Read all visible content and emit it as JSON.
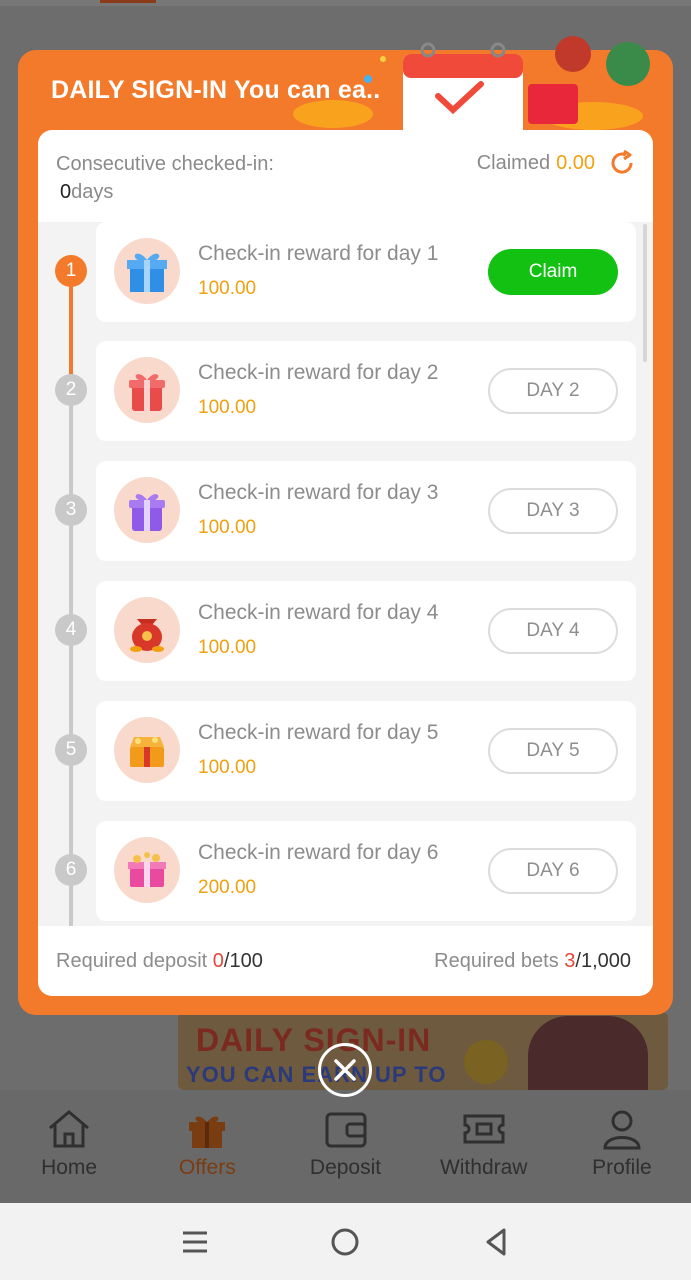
{
  "modal": {
    "title": "DAILY SIGN-IN You can ea..",
    "consecutive_label": "Consecutive checked-in:",
    "consecutive_value": "0",
    "consecutive_unit": "days",
    "claimed_label": "Claimed",
    "claimed_value": "0.00",
    "rows": [
      {
        "step": "1",
        "title": "Check-in reward for day 1",
        "amount": "100.00",
        "button": "Claim",
        "state": "claim"
      },
      {
        "step": "2",
        "title": "Check-in reward for day 2",
        "amount": "100.00",
        "button": "DAY 2",
        "state": "locked"
      },
      {
        "step": "3",
        "title": "Check-in reward for day 3",
        "amount": "100.00",
        "button": "DAY 3",
        "state": "locked"
      },
      {
        "step": "4",
        "title": "Check-in reward for day 4",
        "amount": "100.00",
        "button": "DAY 4",
        "state": "locked"
      },
      {
        "step": "5",
        "title": "Check-in reward for day 5",
        "amount": "100.00",
        "button": "DAY 5",
        "state": "locked"
      },
      {
        "step": "6",
        "title": "Check-in reward for day 6",
        "amount": "200.00",
        "button": "DAY 6",
        "state": "locked"
      }
    ],
    "footer": {
      "deposit_label": "Required deposit",
      "deposit_current": "0",
      "deposit_total": "/100",
      "bets_label": "Required bets",
      "bets_current": "3",
      "bets_total": "/1,000"
    }
  },
  "background": {
    "banner_line1": "DAILY SIGN-IN",
    "banner_line2": "YOU CAN EARN UP TO"
  },
  "bottom_nav": [
    {
      "label": "Home",
      "icon": "home-icon"
    },
    {
      "label": "Offers",
      "icon": "gift-icon"
    },
    {
      "label": "Deposit",
      "icon": "wallet-icon"
    },
    {
      "label": "Withdraw",
      "icon": "ticket-icon"
    },
    {
      "label": "Profile",
      "icon": "person-icon"
    }
  ],
  "colors": {
    "accent": "#f47a2b",
    "claim_green": "#12c112",
    "amount_gold": "#f1a010",
    "required_red": "#e2473a"
  }
}
